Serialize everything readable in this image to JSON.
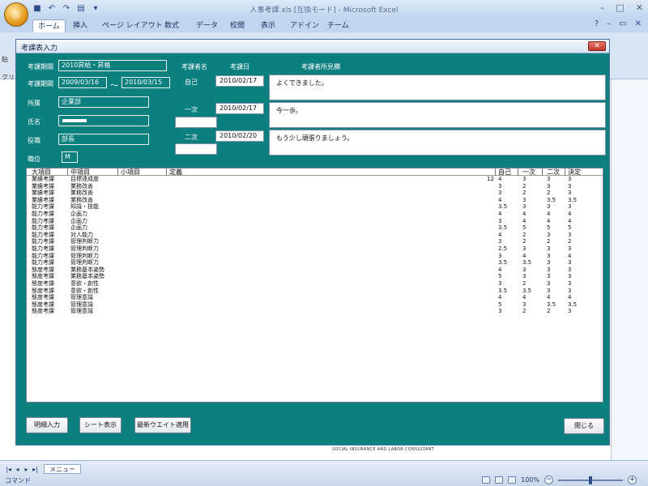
{
  "excel": {
    "title": "人事考課.xls [互換モード] - Microsoft Excel",
    "tabs": [
      "ホーム",
      "挿入",
      "ページ レイアウト",
      "数式",
      "データ",
      "校閲",
      "表示",
      "アドイン",
      "チーム"
    ],
    "sheet_tab": "メニュー",
    "status_mode": "コマンド",
    "zoom": "100%",
    "footer_text": "SOCIAL INSURANCE AND LABOR CONSULTANT",
    "side_ticks": [
      "貼",
      "クリ"
    ]
  },
  "dialog": {
    "title": "考課表入力",
    "labels": {
      "period_name": "考課期間",
      "period": "考課期間",
      "dept": "所属",
      "name": "氏名",
      "position": "役職",
      "grade": "職位",
      "evaluator": "考課者名",
      "eval_date": "考課日",
      "comment": "考課者所見欄",
      "self": "自己",
      "first": "一次",
      "second": "二次"
    },
    "values": {
      "period_name": "2010昇給・昇格",
      "period_from": "2009/03/16",
      "period_sep": "～",
      "period_to": "2010/03/15",
      "dept": "企業部",
      "position": "部長",
      "grade": "M",
      "self_date": "2010/02/17",
      "first_date": "2010/02/17",
      "second_date": "2010/02/20",
      "self_comment": "よくできました。",
      "first_comment": "今一歩。",
      "second_comment": "もう少し頑張りましょう。"
    },
    "list": {
      "headers": [
        "大項目",
        "中項目",
        "小項目",
        "定義",
        "自己",
        "一次",
        "二次",
        "決定"
      ],
      "rows": [
        [
          "業績考課",
          "目標達成度",
          "12",
          "4",
          "3",
          "3",
          "3"
        ],
        [
          "業績考課",
          "業務改善",
          "",
          "3",
          "2",
          "3",
          "3"
        ],
        [
          "業績考課",
          "業務改善",
          "",
          "3",
          "2",
          "2",
          "3"
        ],
        [
          "業績考課",
          "業務改善",
          "",
          "4",
          "3",
          "3.5",
          "3.5"
        ],
        [
          "能力考課",
          "知識・技能",
          "",
          "3.5",
          "3",
          "3",
          "3"
        ],
        [
          "能力考課",
          "企画力",
          "",
          "4",
          "4",
          "4",
          "4"
        ],
        [
          "能力考課",
          "企画力",
          "",
          "3",
          "4",
          "4",
          "4"
        ],
        [
          "能力考課",
          "企画力",
          "",
          "3.5",
          "5",
          "5",
          "5"
        ],
        [
          "能力考課",
          "対人能力",
          "",
          "4",
          "2",
          "3",
          "3"
        ],
        [
          "能力考課",
          "管理判断力",
          "",
          "3",
          "2",
          "2",
          "2"
        ],
        [
          "能力考課",
          "管理判断力",
          "",
          "2.5",
          "3",
          "3",
          "3"
        ],
        [
          "能力考課",
          "管理判断力",
          "",
          "3",
          "4",
          "3",
          "4"
        ],
        [
          "能力考課",
          "管理判断力",
          "",
          "3.5",
          "3.5",
          "3",
          "3"
        ],
        [
          "態度考課",
          "業務基本姿勢",
          "",
          "4",
          "3",
          "3",
          "3"
        ],
        [
          "態度考課",
          "業務基本姿勢",
          "",
          "5",
          "3",
          "3",
          "3"
        ],
        [
          "態度考課",
          "意欲・創性",
          "",
          "3",
          "2",
          "3",
          "3"
        ],
        [
          "態度考課",
          "意欲・創性",
          "",
          "3.5",
          "3.5",
          "3",
          "3"
        ],
        [
          "態度考課",
          "管理意識",
          "",
          "4",
          "4",
          "4",
          "4"
        ],
        [
          "態度考課",
          "管理意識",
          "",
          "5",
          "3",
          "3.5",
          "3.5"
        ],
        [
          "態度考課",
          "管理意識",
          "",
          "3",
          "2",
          "2",
          "3"
        ]
      ]
    },
    "buttons": {
      "detail": "明細入力",
      "sheet": "シート表示",
      "weight": "最新ウエイト適用",
      "close": "閉じる"
    }
  }
}
